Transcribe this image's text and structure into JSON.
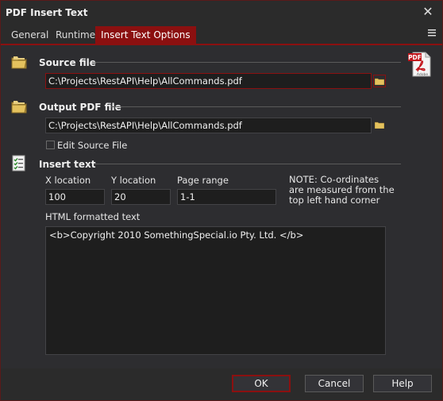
{
  "window": {
    "title": "PDF Insert Text",
    "close_glyph": "✕"
  },
  "tabs": [
    {
      "label": "General",
      "active": false
    },
    {
      "label": "Runtime",
      "active": false
    },
    {
      "label": "Insert Text Options",
      "active": true
    }
  ],
  "tab_menu_icon": "hamburger-icon",
  "source_file": {
    "section_label": "Source file",
    "value": "C:\\Projects\\RestAPI\\Help\\AllCommands.pdf"
  },
  "output_file": {
    "section_label": "Output PDF file",
    "value": "C:\\Projects\\RestAPI\\Help\\AllCommands.pdf",
    "edit_source_label": "Edit Source File",
    "edit_source_checked": false
  },
  "insert_text": {
    "section_label": "Insert text",
    "x_label": "X location",
    "x_value": "100",
    "y_label": "Y location",
    "y_value": "20",
    "page_range_label": "Page range",
    "page_range_value": "1-1",
    "note": "NOTE: Co-ordinates are measured from the top left hand corner",
    "html_label": "HTML formatted text",
    "html_value": "<b>Copyright 2010 SomethingSpecial.io Pty. Ltd. </b>"
  },
  "pdf_logo": {
    "badge": "PDF",
    "caption": "Adobe"
  },
  "buttons": {
    "ok": "OK",
    "cancel": "Cancel",
    "help": "Help"
  },
  "colors": {
    "accent": "#8b1010",
    "background": "#2d2d30",
    "field": "#1e1e1e"
  }
}
